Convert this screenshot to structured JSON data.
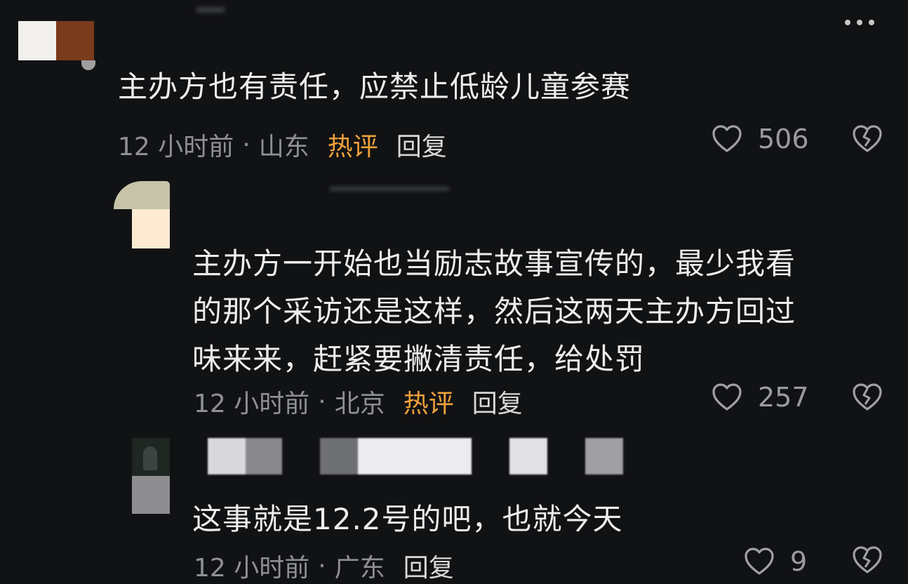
{
  "comments": [
    {
      "text": "主办方也有责任，应禁止低龄儿童参赛",
      "time": "12 小时前",
      "location": "山东",
      "badge": "热评",
      "reply_label": "回复",
      "likes": "506"
    },
    {
      "text": "主办方一开始也当励志故事宣传的，最少我看\n的那个采访还是这样，然后这两天主办方回过\n味来来，赶紧要撇清责任，给处罚",
      "time": "12 小时前",
      "location": "北京",
      "badge": "热评",
      "reply_label": "回复",
      "likes": "257"
    },
    {
      "text": "这事就是12.2号的吧，也就今天",
      "time": "12 小时前",
      "location": "广东",
      "reply_label": "回复",
      "likes": "9"
    }
  ],
  "separator": "·",
  "icons": {
    "like": "heart-outline-icon",
    "dislike": "broken-heart-icon",
    "more": "more-dots-icon"
  },
  "colors": {
    "background": "#111214",
    "text": "#ededed",
    "meta": "#8f9094",
    "hot_badge": "#f0a23a"
  }
}
